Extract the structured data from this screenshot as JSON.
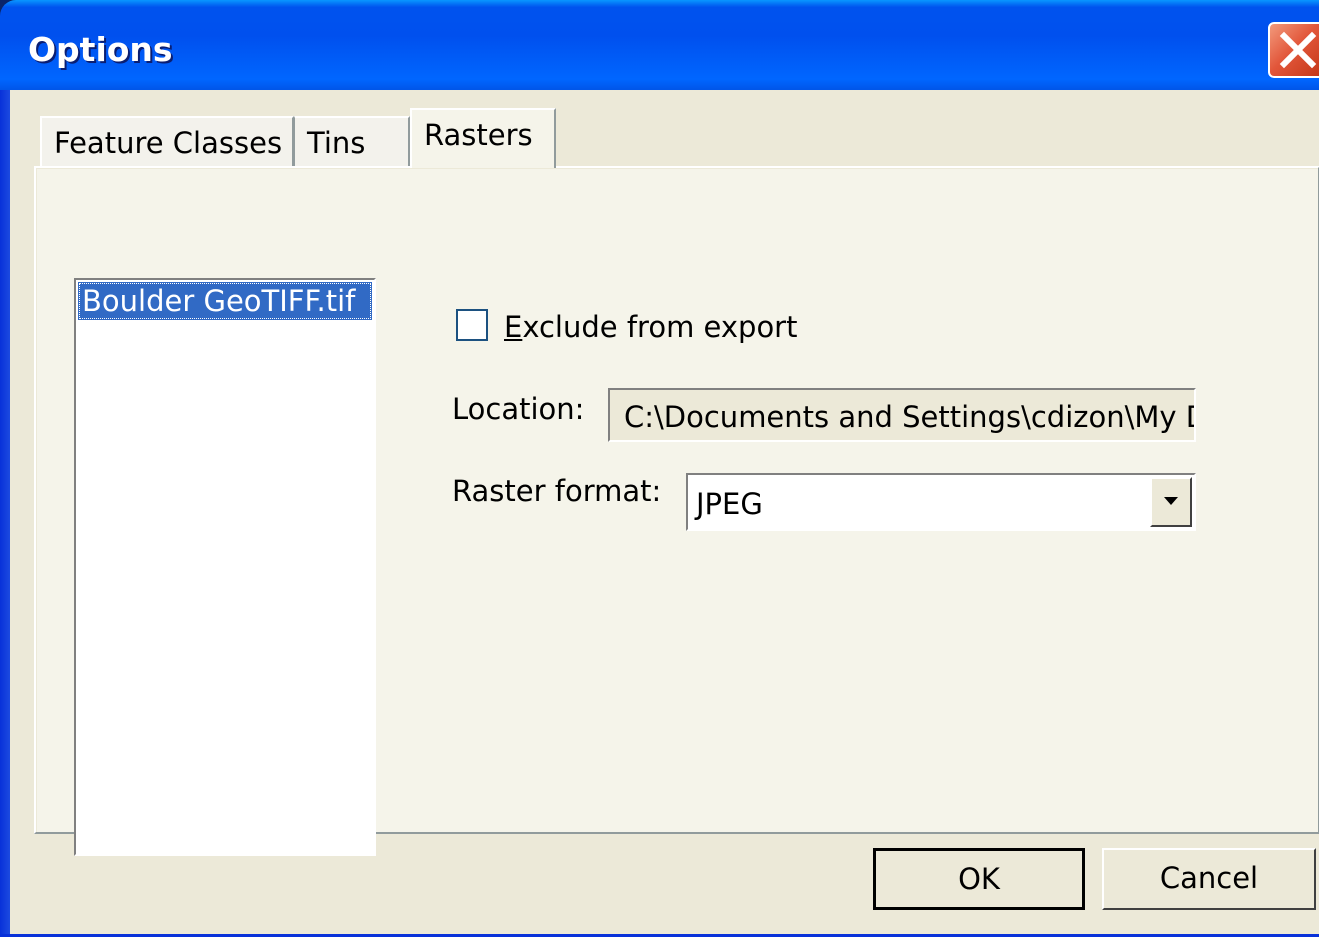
{
  "window": {
    "title": "Options"
  },
  "tabs": [
    {
      "label": "Feature Classes",
      "active": false
    },
    {
      "label": "Tins",
      "active": false
    },
    {
      "label": "Rasters",
      "active": true
    }
  ],
  "list": {
    "items": [
      "Boulder GeoTIFF.tif"
    ],
    "selected_index": 0
  },
  "exclude_checkbox": {
    "label_accel": "E",
    "label_rest": "xclude from export",
    "checked": false
  },
  "location": {
    "label": "Location:",
    "value": "C:\\Documents and Settings\\cdizon\\My Dc"
  },
  "raster_format": {
    "label": "Raster format:",
    "value": "JPEG"
  },
  "buttons": {
    "ok": "OK",
    "cancel": "Cancel"
  },
  "icons": {
    "close": "close-icon",
    "dropdown": "chevron-down-icon"
  },
  "colors": {
    "titlebar": "#0055e8",
    "dialog_bg": "#ece9d8",
    "selection": "#316ac5"
  }
}
